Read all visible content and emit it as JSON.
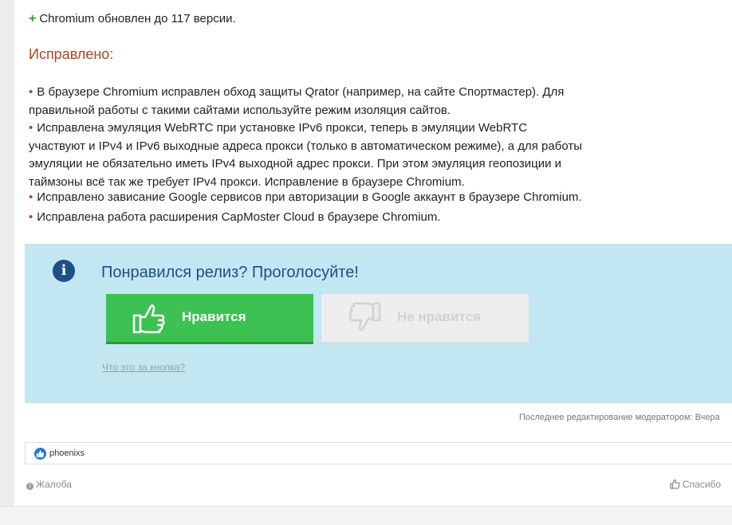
{
  "update_line": {
    "plus": "+",
    "text": "Chromium обновлен до 117 версии."
  },
  "fixed": {
    "heading": "Исправлено:",
    "bullet_symbol": "•",
    "items": [
      "В браузере Chromium исправлен обход защиты Qrator (например, на сайте Спортмастер). Для правильной работы с такими сайтами используйте режим изоляция сайтов.",
      "Исправлена эмуляция WebRTC при установке IPv6 прокси, теперь в эмуляции WebRTC участвуют и IPv4 и IPv6 выходные адреса прокси (только в автоматическом режиме), а для работы эмуляции не обязательно иметь IPv4 выходной адрес прокси. При этом эмуляция геопозиции и таймзоны всё так же требует IPv4 прокси. Исправление в браузере Chromium.",
      "Исправлено зависание Google сервисов при авторизации в Google аккаунт в браузере Chromium.",
      "Исправлена работа расширения CapMoster Cloud в браузере Chromium."
    ]
  },
  "vote": {
    "info_icon": "i",
    "title": "Понравился релиз? Проголосуйте!",
    "like_label": "Нравится",
    "dislike_label": "Не нравится",
    "what_link": "Что это за кнопка?",
    "like_icon": "thumbs-up-icon",
    "dislike_icon": "thumbs-down-icon"
  },
  "edit_note": "Последнее редактирование модератором: Вчера",
  "reactions": {
    "user": "phoenixs",
    "icon": "like-reaction-icon"
  },
  "actions": {
    "report": "Жалоба",
    "report_icon_glyph": "!",
    "thanks": "Спасибо"
  },
  "colors": {
    "accent_red": "#b34223",
    "like_green": "#3cc152",
    "vote_bg": "#c2e6f2",
    "title_blue": "#1f4f82",
    "plus_green": "#2e9e2e"
  }
}
